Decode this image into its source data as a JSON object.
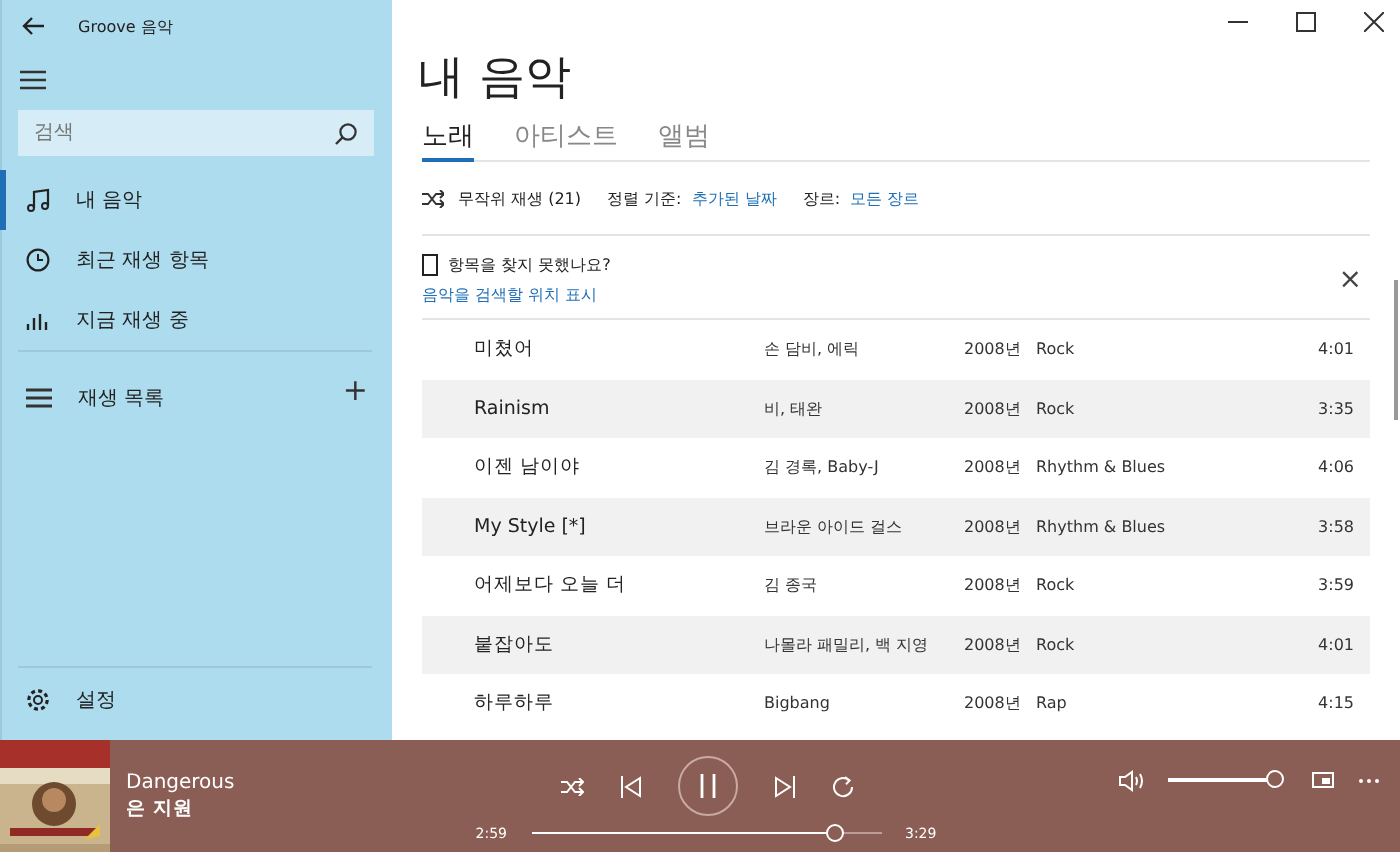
{
  "window": {
    "title": "Groove 음악"
  },
  "search": {
    "placeholder": "검색"
  },
  "nav": [
    {
      "label": "내 음악",
      "selected": true
    },
    {
      "label": "최근 재생 항목",
      "selected": false
    },
    {
      "label": "지금 재생 중",
      "selected": false
    }
  ],
  "playlists": {
    "label": "재생 목록",
    "add": "+"
  },
  "settings": {
    "label": "설정"
  },
  "page_title": "내 음악",
  "tabs": [
    {
      "label": "노래",
      "selected": true
    },
    {
      "label": "아티스트",
      "selected": false
    },
    {
      "label": "앨범",
      "selected": false
    }
  ],
  "toolbar": {
    "shuffle": "무작위 재생 (21)",
    "sort_label": "정렬 기준:",
    "sort_value": "추가된 날짜",
    "genre_label": "장르:",
    "genre_value": "모든 장르"
  },
  "notice": {
    "text": "항목을 찾지 못했나요?",
    "link": "음악을 검색할 위치 표시",
    "close": "×"
  },
  "songs": [
    {
      "title": "미쳤어",
      "artist": "손 담비, 에릭",
      "year": "2008년",
      "genre": "Rock",
      "duration": "4:01"
    },
    {
      "title": "Rainism",
      "artist": "비, 태완",
      "year": "2008년",
      "genre": "Rock",
      "duration": "3:35"
    },
    {
      "title": "이젠 남이야",
      "artist": "김 경록, Baby-J",
      "year": "2008년",
      "genre": "Rhythm & Blues",
      "duration": "4:06"
    },
    {
      "title": "My Style [*]",
      "artist": "브라운 아이드 걸스",
      "year": "2008년",
      "genre": "Rhythm & Blues",
      "duration": "3:58"
    },
    {
      "title": "어제보다 오늘 더",
      "artist": "김 종국",
      "year": "2008년",
      "genre": "Rock",
      "duration": "3:59"
    },
    {
      "title": "붙잡아도",
      "artist": "나몰라 패밀리, 백 지영",
      "year": "2008년",
      "genre": "Rock",
      "duration": "4:01"
    },
    {
      "title": "하루하루",
      "artist": "Bigbang",
      "year": "2008년",
      "genre": "Rap",
      "duration": "4:15"
    }
  ],
  "player": {
    "title": "Dangerous",
    "artist": "은 지원",
    "elapsed": "2:59",
    "total": "3:29",
    "level": 0.87,
    "volume": {
      "level": 1
    },
    "playing": true
  }
}
